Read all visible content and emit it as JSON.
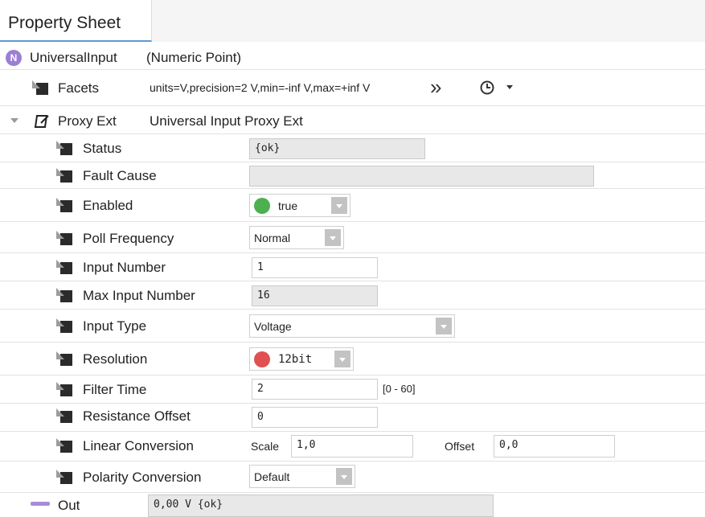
{
  "tab": {
    "title": "Property Sheet"
  },
  "header": {
    "badge": "N",
    "name": "UniversalInput",
    "type": "(Numeric Point)"
  },
  "facets": {
    "label": "Facets",
    "value": "units=V,precision=2 V,min=-inf V,max=+inf V",
    "more_icon": "double-chevron-right-icon",
    "clock_icon": "clock-icon",
    "menu_icon": "dropdown-caret-icon"
  },
  "proxy": {
    "label": "Proxy Ext",
    "value": "Universal Input Proxy Ext"
  },
  "props": {
    "status": {
      "label": "Status",
      "value": "{ok}"
    },
    "fault_cause": {
      "label": "Fault Cause",
      "value": ""
    },
    "enabled": {
      "label": "Enabled",
      "value": "true",
      "dot_color": "#4caf50"
    },
    "poll_frequency": {
      "label": "Poll Frequency",
      "value": "Normal"
    },
    "input_number": {
      "label": "Input Number",
      "value": "1"
    },
    "max_input_number": {
      "label": "Max Input Number",
      "value": "16"
    },
    "input_type": {
      "label": "Input Type",
      "value": "Voltage"
    },
    "resolution": {
      "label": "Resolution",
      "value": "12bit",
      "dot_color": "#e05050"
    },
    "filter_time": {
      "label": "Filter Time",
      "value": "2",
      "range": "[0 - 60]"
    },
    "resistance_offset": {
      "label": "Resistance Offset",
      "value": "0"
    },
    "linear_conversion": {
      "label": "Linear Conversion",
      "scale_label": "Scale",
      "scale_value": "1,0",
      "offset_label": "Offset",
      "offset_value": "0,0"
    },
    "polarity_conversion": {
      "label": "Polarity Conversion",
      "value": "Default"
    }
  },
  "out": {
    "label": "Out",
    "value": "0,00 V {ok}"
  }
}
